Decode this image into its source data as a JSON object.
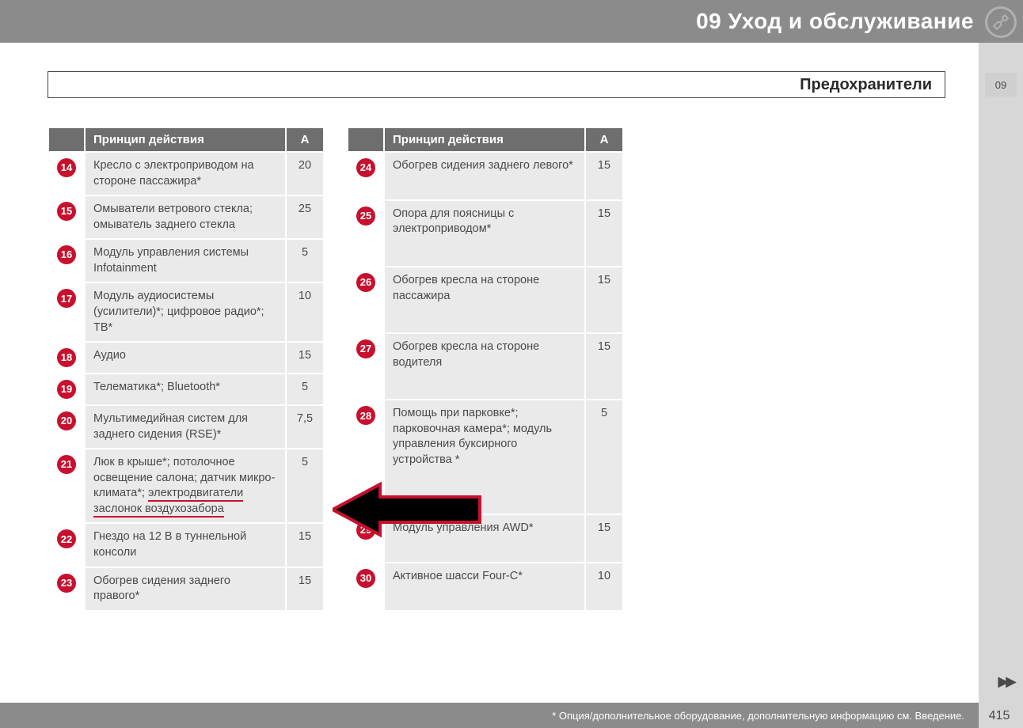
{
  "header": {
    "chapter": "09 Уход и обслуживание",
    "section": "Предохранители",
    "tab": "09"
  },
  "table_headers": {
    "col1": "",
    "col2": "Принцип действия",
    "col3": "A"
  },
  "left_rows": [
    {
      "num": "14",
      "desc": "Кресло с электроприводом на стороне пассажира*",
      "amp": "20"
    },
    {
      "num": "15",
      "desc": "Омыватели ветрового стекла; омыватель заднего стекла",
      "amp": "25"
    },
    {
      "num": "16",
      "desc": "Модуль управления системы Infotainment",
      "amp": "5"
    },
    {
      "num": "17",
      "desc": "Модуль аудиосистемы (усилители)*; цифровое радио*; ТВ*",
      "amp": "10"
    },
    {
      "num": "18",
      "desc": "Аудио",
      "amp": "15"
    },
    {
      "num": "19",
      "desc": "Телематика*; Bluetooth*",
      "amp": "5"
    },
    {
      "num": "20",
      "desc": "Мультимедийная систем для заднего сидения (RSE)*",
      "amp": "7,5"
    },
    {
      "num": "21",
      "desc_pre": "Люк в крыше*; потолочное освещение салона; датчик микро-климата*; ",
      "desc_underline": "электродвигатели заслонок воздухозабора",
      "amp": "5"
    },
    {
      "num": "22",
      "desc": "Гнездо на 12 В в туннельной консоли",
      "amp": "15"
    },
    {
      "num": "23",
      "desc": "Обогрев сидения заднего правого*",
      "amp": "15"
    }
  ],
  "right_rows": [
    {
      "num": "24",
      "desc": "Обогрев сидения заднего левого*",
      "amp": "15"
    },
    {
      "num": "25",
      "desc": "Опора для поясницы с электроприводом*",
      "amp": "15"
    },
    {
      "num": "26",
      "desc": "Обогрев кресла на стороне пассажира",
      "amp": "15"
    },
    {
      "num": "27",
      "desc": "Обогрев кресла на стороне водителя",
      "amp": "15"
    },
    {
      "num": "28",
      "desc": "Помощь при парковке*; парковочная камера*; модуль управления буксирного устройства *",
      "amp": "5"
    },
    {
      "num": "29",
      "desc": "Модуль управления AWD*",
      "amp": "15"
    },
    {
      "num": "30",
      "desc": "Активное шасси Four-C*",
      "amp": "10"
    }
  ],
  "footer": {
    "note": "* Опция/дополнительное оборудование, дополнительную информацию см. Введение.",
    "page": "415",
    "pager": "▶▶"
  }
}
